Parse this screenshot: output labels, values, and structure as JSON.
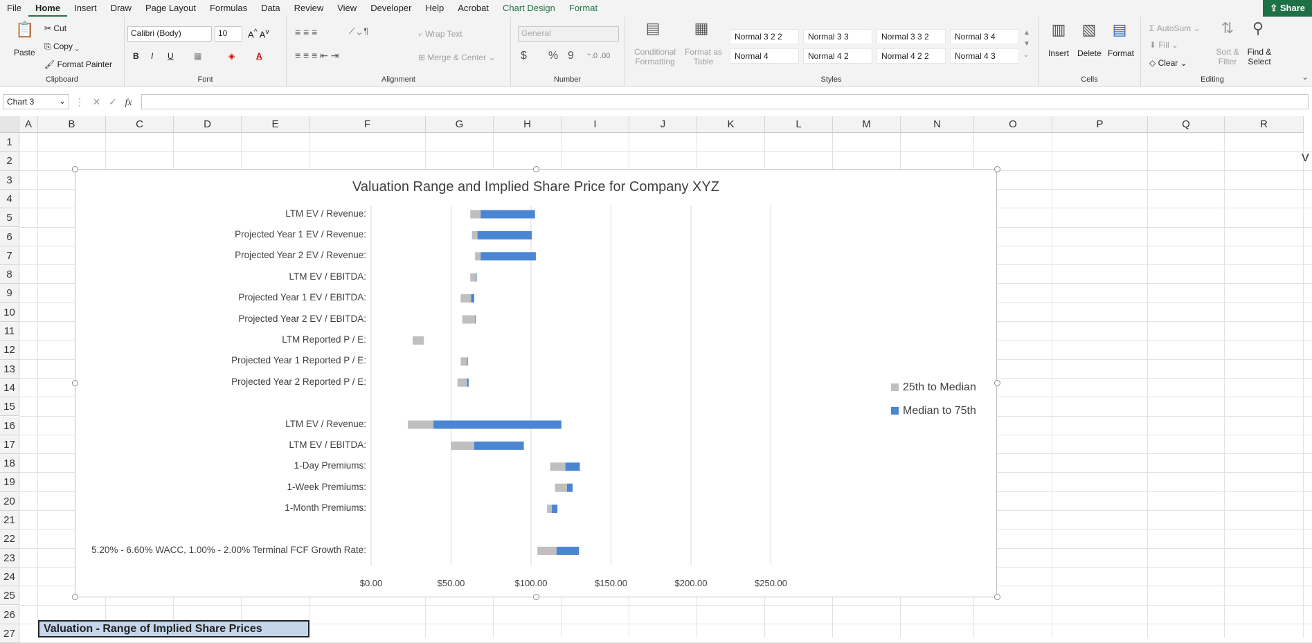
{
  "menu": {
    "items": [
      "File",
      "Home",
      "Insert",
      "Draw",
      "Page Layout",
      "Formulas",
      "Data",
      "Review",
      "View",
      "Developer",
      "Help",
      "Acrobat",
      "Chart Design",
      "Format"
    ],
    "share": "Share"
  },
  "ribbon": {
    "clipboard": {
      "paste": "Paste",
      "cut": "Cut",
      "copy": "Copy",
      "format_painter": "Format Painter",
      "label": "Clipboard"
    },
    "font": {
      "name": "Calibri (Body)",
      "size": "10",
      "label": "Font",
      "bold": "B",
      "italic": "I",
      "underline": "U"
    },
    "alignment": {
      "wrap": "Wrap Text",
      "merge": "Merge & Center",
      "label": "Alignment"
    },
    "number": {
      "format": "General",
      "label": "Number",
      "currency": "$",
      "percent": "%",
      "comma": "9"
    },
    "styles": {
      "conditional": "Conditional Formatting",
      "format_table": "Format as Table",
      "cells": [
        "Normal 3 2 2",
        "Normal 3 3",
        "Normal 3 3 2",
        "Normal 3 4",
        "Normal 4",
        "Normal 4 2",
        "Normal 4 2 2",
        "Normal 4 3"
      ],
      "label": "Styles"
    },
    "cells": {
      "insert": "Insert",
      "delete": "Delete",
      "format": "Format",
      "label": "Cells"
    },
    "editing": {
      "autosum": "AutoSum",
      "fill": "Fill",
      "clear": "Clear",
      "sort": "Sort & Filter",
      "find": "Find & Select",
      "label": "Editing"
    }
  },
  "formula_bar": {
    "name_box": "Chart 3",
    "fx": "fx",
    "cancel": "✕",
    "enter": "✓",
    "formula": ""
  },
  "columns": [
    "A",
    "B",
    "C",
    "D",
    "E",
    "F",
    "G",
    "H",
    "I",
    "J",
    "K",
    "L",
    "M",
    "N",
    "O",
    "P",
    "Q",
    "R"
  ],
  "rows": [
    "1",
    "2",
    "3",
    "4",
    "5",
    "6",
    "7",
    "8",
    "9",
    "10",
    "11",
    "12",
    "13",
    "14",
    "15",
    "16",
    "17",
    "18",
    "19",
    "20",
    "21",
    "22",
    "23",
    "24",
    "25",
    "26",
    "27"
  ],
  "cell_text": {
    "r2": "V"
  },
  "bottom_cell": "Valuation - Range of Implied Share Prices",
  "chart_data": {
    "type": "bar",
    "orientation": "horizontal-stacked-floating",
    "title": "Valuation Range and Implied Share Price for Company XYZ",
    "categories": [
      "LTM EV / Revenue:",
      "Projected Year 1 EV / Revenue:",
      "Projected Year 2 EV / Revenue:",
      "LTM EV / EBITDA:",
      "Projected Year 1 EV / EBITDA:",
      "Projected Year 2 EV / EBITDA:",
      "LTM Reported P / E:",
      "Projected Year 1 Reported P / E:",
      "Projected Year 2 Reported P / E:",
      "",
      "LTM EV / Revenue:",
      "LTM EV / EBITDA:",
      "1-Day Premiums:",
      "1-Week Premiums:",
      "1-Month Premiums:",
      "",
      "5.20% - 6.60% WACC, 1.00% - 2.00% Terminal FCF Growth Rate:"
    ],
    "series": [
      {
        "name": "25th to Median",
        "color": "#bfbfbf",
        "start": [
          62,
          63,
          65,
          62,
          56,
          57,
          26,
          56,
          54,
          null,
          23,
          50,
          112,
          115,
          110,
          null,
          104
        ],
        "values": [
          6.5,
          3.5,
          3.5,
          3.5,
          6.5,
          8,
          7,
          4,
          6,
          null,
          16,
          14.5,
          9.5,
          7.5,
          3,
          null,
          12
        ]
      },
      {
        "name": "Median to 75th",
        "color": "#4a86d4",
        "values": [
          34,
          34,
          34.5,
          0.5,
          2,
          0.5,
          0,
          0.5,
          1,
          null,
          80,
          31,
          9,
          3.5,
          3.5,
          null,
          14
        ]
      }
    ],
    "xticks": [
      "$0.00",
      "$50.00",
      "$100.00",
      "$150.00",
      "$200.00",
      "$250.00"
    ],
    "xlim": [
      0,
      300
    ],
    "grid": true,
    "legend": "right"
  }
}
